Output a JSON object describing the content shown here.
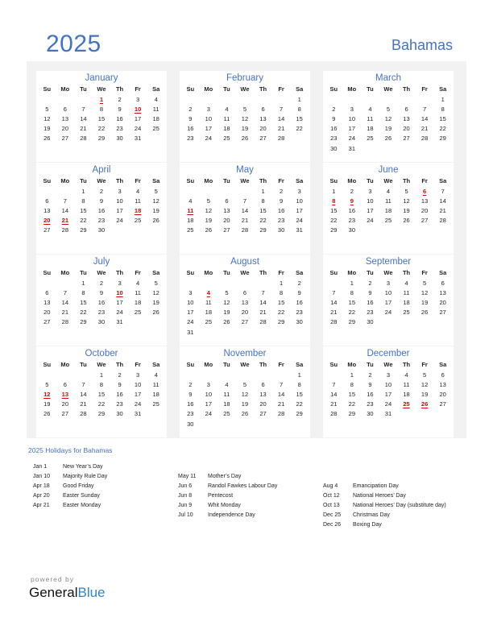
{
  "header": {
    "year": "2025",
    "country": "Bahamas"
  },
  "weekdays": [
    "Su",
    "Mo",
    "Tu",
    "We",
    "Th",
    "Fr",
    "Sa"
  ],
  "months": [
    {
      "name": "January",
      "start": 3,
      "days": 31,
      "holidays": [
        1,
        10
      ]
    },
    {
      "name": "February",
      "start": 6,
      "days": 28,
      "holidays": []
    },
    {
      "name": "March",
      "start": 6,
      "days": 31,
      "holidays": []
    },
    {
      "name": "April",
      "start": 2,
      "days": 30,
      "holidays": [
        18,
        20,
        21
      ]
    },
    {
      "name": "May",
      "start": 4,
      "days": 31,
      "holidays": [
        11
      ]
    },
    {
      "name": "June",
      "start": 0,
      "days": 30,
      "holidays": [
        6,
        8,
        9
      ]
    },
    {
      "name": "July",
      "start": 2,
      "days": 31,
      "holidays": [
        10
      ]
    },
    {
      "name": "August",
      "start": 5,
      "days": 31,
      "holidays": [
        4
      ]
    },
    {
      "name": "September",
      "start": 1,
      "days": 30,
      "holidays": []
    },
    {
      "name": "October",
      "start": 3,
      "days": 31,
      "holidays": [
        12,
        13
      ]
    },
    {
      "name": "November",
      "start": 6,
      "days": 30,
      "holidays": []
    },
    {
      "name": "December",
      "start": 1,
      "days": 31,
      "holidays": [
        25,
        26
      ]
    }
  ],
  "holidays_title": "2025 Holidays for Bahamas",
  "holiday_columns": [
    [
      {
        "date": "Jan 1",
        "name": "New Year’s Day"
      },
      {
        "date": "Jan 10",
        "name": "Majority Rule Day"
      },
      {
        "date": "Apr 18",
        "name": "Good Friday"
      },
      {
        "date": "Apr 20",
        "name": "Easter Sunday"
      },
      {
        "date": "Apr 21",
        "name": "Easter Monday"
      }
    ],
    [
      {
        "date": "May 11",
        "name": "Mother’s Day"
      },
      {
        "date": "Jun 6",
        "name": "Randol Fawkes Labour Day"
      },
      {
        "date": "Jun 8",
        "name": "Pentecost"
      },
      {
        "date": "Jun 9",
        "name": "Whit Monday"
      },
      {
        "date": "Jul 10",
        "name": "Independence Day"
      }
    ],
    [
      {
        "date": "Aug 4",
        "name": "Emancipation Day"
      },
      {
        "date": "Oct 12",
        "name": "National Heroes’ Day"
      },
      {
        "date": "Oct 13",
        "name": "National Heroes’ Day (substitute day)"
      },
      {
        "date": "Dec 25",
        "name": "Christmas Day"
      },
      {
        "date": "Dec 26",
        "name": "Boxing Day"
      }
    ]
  ],
  "footer": {
    "powered_by": "powered by",
    "brand_part1": "General",
    "brand_part2": "Blue"
  },
  "colors": {
    "accent": "#4472c4",
    "holiday": "#e00000",
    "panel": "#f2f2f2",
    "brand_blue": "#2e86c8"
  }
}
